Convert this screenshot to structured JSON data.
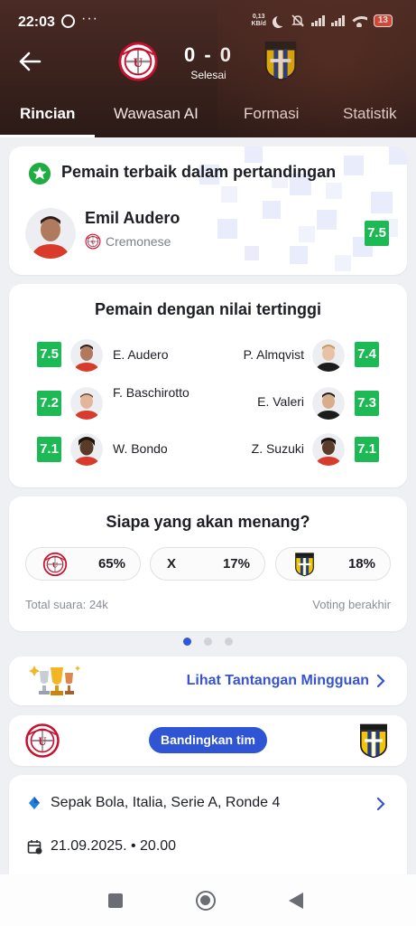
{
  "status_bar": {
    "time": "22:03",
    "icons": [
      "whatsapp-icon",
      "more-dots-icon"
    ],
    "more": "···",
    "speed_value": "0,13",
    "speed_unit": "KB/d",
    "right_icons": [
      "moon-icon",
      "mute-icon",
      "signal-icon",
      "signal-icon",
      "wifi-icon"
    ],
    "battery": "13"
  },
  "match": {
    "home_team": "Cremonese",
    "away_team": "Parma",
    "score": "0 - 0",
    "status": "Selesai",
    "home_color": "#c8102e",
    "away_color": "#f5c400"
  },
  "tabs": [
    {
      "label": "Rincian",
      "active": true
    },
    {
      "label": "Wawasan AI",
      "active": false
    },
    {
      "label": "Formasi",
      "active": false
    },
    {
      "label": "Statistik",
      "active": false
    }
  ],
  "best_player": {
    "title": "Pemain terbaik dalam pertandingan",
    "name": "Emil Audero",
    "team": "Cremonese",
    "rating": "7.5"
  },
  "top_rated": {
    "title": "Pemain dengan nilai tertinggi",
    "home": [
      {
        "name": "E. Audero",
        "rating": "7.5"
      },
      {
        "name": "F. Baschirotto",
        "rating": "7.2"
      },
      {
        "name": "W. Bondo",
        "rating": "7.1"
      }
    ],
    "away": [
      {
        "name": "P. Almqvist",
        "rating": "7.4"
      },
      {
        "name": "E. Valeri",
        "rating": "7.3"
      },
      {
        "name": "Z. Suzuki",
        "rating": "7.1"
      }
    ]
  },
  "vote": {
    "title": "Siapa yang akan menang?",
    "home_pct": "65%",
    "draw_label": "X",
    "draw_pct": "17%",
    "away_pct": "18%",
    "total": "Total suara: 24k",
    "status": "Voting berakhir"
  },
  "carousel": {
    "pages": 3,
    "active": 0
  },
  "challenge": {
    "label": "Lihat Tantangan Mingguan"
  },
  "compare": {
    "label": "Bandingkan tim"
  },
  "info": {
    "league": "Sepak Bola, Italia, Serie A, Ronde 4",
    "date": "21.09.2025. • 20.00"
  },
  "colors": {
    "rating_green": "#1db954",
    "accent_blue": "#2f55d4",
    "header_brown": "#3a221d"
  }
}
